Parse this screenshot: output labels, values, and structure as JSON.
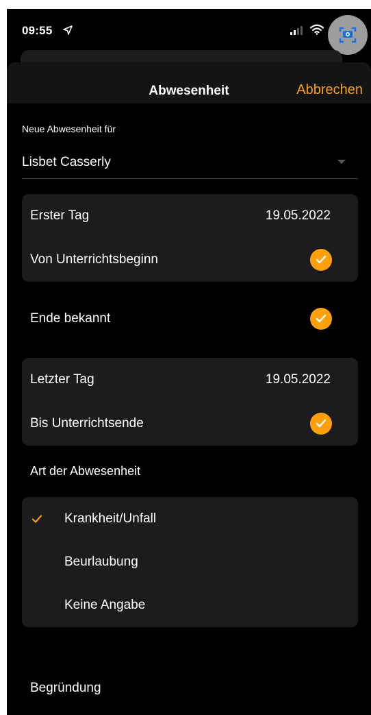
{
  "status_bar": {
    "time": "09:55",
    "icons": [
      "location-arrow-icon",
      "signal-bars-icon",
      "wifi-icon",
      "screen-record-icon"
    ]
  },
  "nav": {
    "title": "Abwesenheit",
    "cancel_label": "Abbrechen"
  },
  "form": {
    "person_caption": "Neue Abwesenheit für",
    "person_name": "Lisbet Casserly",
    "first_day_label": "Erster Tag",
    "first_day_value": "19.05.2022",
    "from_start_label": "Von Unterrichtsbeginn",
    "from_start_checked": true,
    "end_known_label": "Ende bekannt",
    "end_known_checked": true,
    "last_day_label": "Letzter Tag",
    "last_day_value": "19.05.2022",
    "until_end_label": "Bis Unterrichtsende",
    "until_end_checked": true,
    "type_heading": "Art der Abwesenheit",
    "type_options": [
      {
        "label": "Krankheit/Unfall",
        "selected": true
      },
      {
        "label": "Beurlaubung",
        "selected": false
      },
      {
        "label": "Keine Angabe",
        "selected": false
      }
    ],
    "reason_label": "Begründung"
  },
  "colors": {
    "accent": "#ff9f0a",
    "background": "#000000",
    "group_background": "#1c1c1e",
    "text": "#ffffff"
  }
}
